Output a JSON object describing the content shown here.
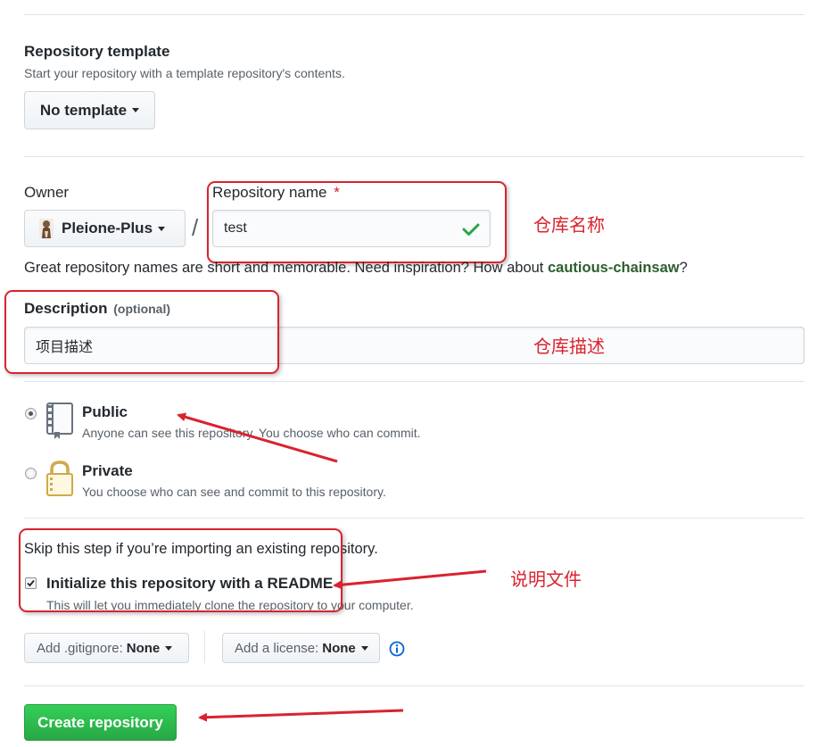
{
  "template": {
    "title": "Repository template",
    "note": "Start your repository with a template repository's contents.",
    "button_label": "No template"
  },
  "owner": {
    "label": "Owner",
    "value": "Pleione-Plus"
  },
  "separator": "/",
  "repo_name": {
    "label": "Repository name",
    "required_mark": "*",
    "value": "test",
    "annotation": "仓库名称"
  },
  "suggestion": {
    "text": "Great repository names are short and memorable. Need inspiration? How about",
    "name": "cautious-chainsaw",
    "end": "?"
  },
  "description": {
    "label": "Description",
    "optional": "(optional)",
    "value": "项目描述",
    "annotation": "仓库描述"
  },
  "visibility": {
    "public": {
      "label": "Public",
      "note": "Anyone can see this repository. You choose who can commit.",
      "selected": true
    },
    "private": {
      "label": "Private",
      "note": "You choose who can see and commit to this repository.",
      "selected": false
    }
  },
  "init": {
    "skip_note": "Skip this step if you’re importing an existing repository.",
    "readme_label": "Initialize this repository with a README",
    "readme_note": "This will let you immediately clone the repository to your computer.",
    "readme_checked": true,
    "annotation": "说明文件"
  },
  "gitignore": {
    "prefix": "Add .gitignore:",
    "value": "None"
  },
  "license": {
    "prefix": "Add a license:",
    "value": "None"
  },
  "create_button": "Create repository",
  "colors": {
    "accent_red": "#d9232e",
    "success_green": "#28a745",
    "link_green": "#2c5f2d",
    "info_blue": "#0366d6"
  }
}
